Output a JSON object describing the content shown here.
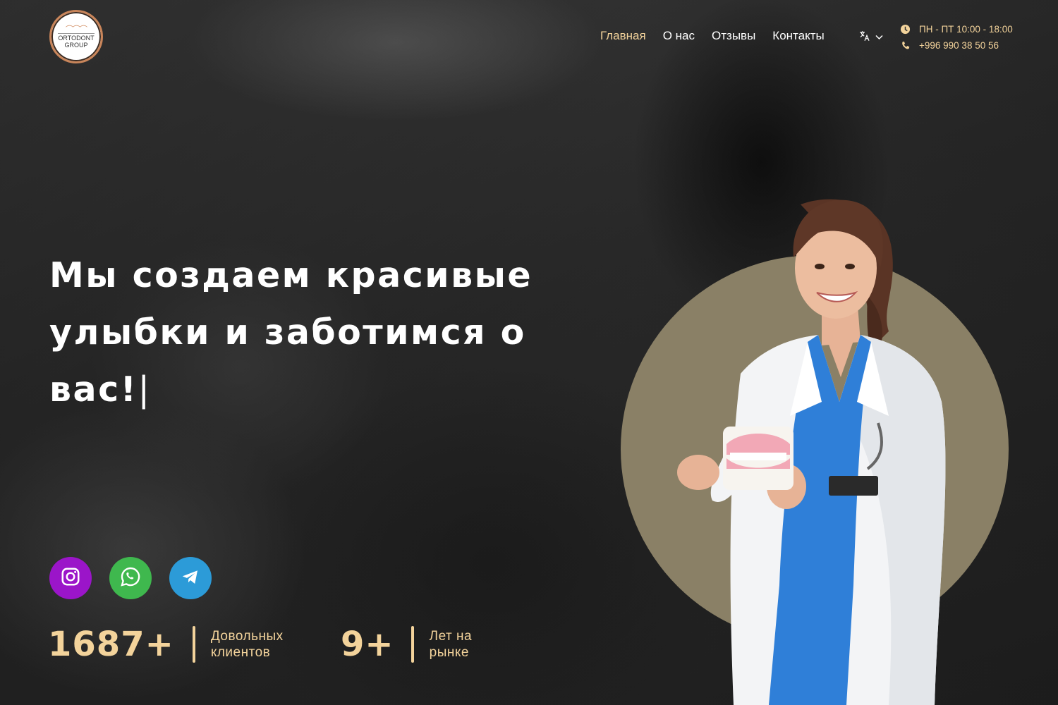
{
  "brand": {
    "logo_line1": "ORTODONT",
    "logo_line2": "GROUP",
    "accent_color": "#f3d39b",
    "logo_ring_color": "#c9855a"
  },
  "nav": {
    "items": [
      {
        "label": "Главная",
        "active": true
      },
      {
        "label": "О нас",
        "active": false
      },
      {
        "label": "Отзывы",
        "active": false
      },
      {
        "label": "Контакты",
        "active": false
      }
    ]
  },
  "language": {
    "icon": "translate-icon"
  },
  "contact": {
    "hours": "ПН - ПТ 10:00 - 18:00",
    "phone": "+996 990 38 50 56"
  },
  "hero": {
    "headline_line1": "Мы создаем красивые",
    "headline_line2": "улыбки и заботимся о",
    "headline_line3": "вас!",
    "cursor": "|"
  },
  "socials": [
    {
      "name": "instagram",
      "icon": "instagram-icon",
      "color": "#9b15c9"
    },
    {
      "name": "whatsapp",
      "icon": "whatsapp-icon",
      "color": "#3fb84e"
    },
    {
      "name": "telegram",
      "icon": "telegram-icon",
      "color": "#2c9bd8"
    }
  ],
  "stats": [
    {
      "value": "1687+",
      "label_line1": "Довольных",
      "label_line2": "клиентов"
    },
    {
      "value": "9+",
      "label_line1": "Лет на",
      "label_line2": "рынке"
    }
  ]
}
